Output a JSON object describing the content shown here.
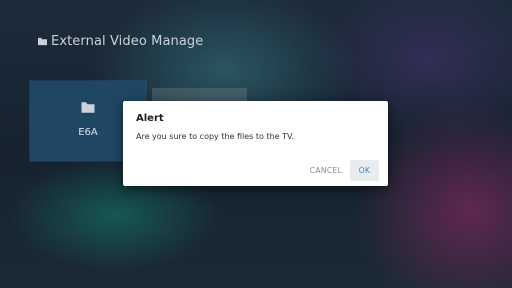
{
  "header": {
    "title": "External Video Manage",
    "icon": "folder-icon"
  },
  "grid": {
    "items": [
      {
        "label": "E6A",
        "icon": "folder-icon"
      },
      {
        "label": ""
      }
    ]
  },
  "dialog": {
    "title": "Alert",
    "message": "Are you sure to copy the files to the TV.",
    "cancel_label": "CANCEL",
    "ok_label": "OK"
  },
  "colors": {
    "tile_focused": "#1f4764",
    "accent": "#2a8fc7",
    "dialog_background": "#ffffff"
  }
}
